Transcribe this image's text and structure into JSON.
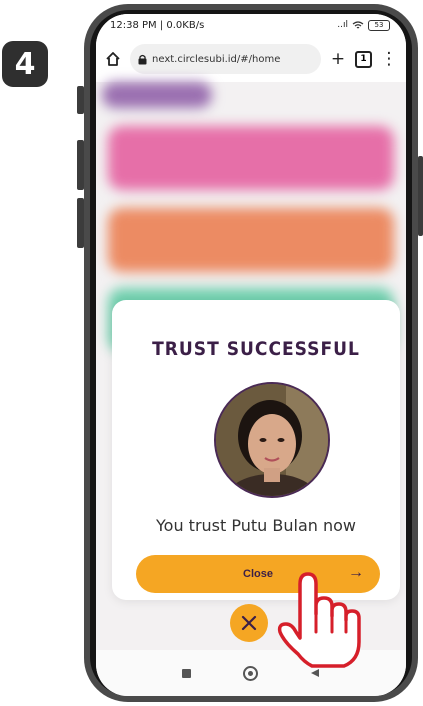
{
  "step": {
    "number": "4"
  },
  "statusbar": {
    "time_info": "12:38 PM | 0.0KB/s",
    "signal": "..ıl",
    "battery": "53"
  },
  "browser": {
    "url": "next.circlesubi.id/#/home",
    "tab_count": "1"
  },
  "modal": {
    "title": "TRUST SUCCESSFUL",
    "message": "You trust Putu Bulan now",
    "close_label": "Close"
  },
  "colors": {
    "accent": "#f5a623",
    "title": "#3b1f47",
    "card_pink": "#e66fa8",
    "card_orange": "#ec8b63",
    "card_teal": "#6fcfad",
    "hand_outline": "#d61f2a"
  },
  "icons": {
    "home": "home-icon",
    "lock": "lock-icon",
    "plus": "plus-icon",
    "more": "more-vertical-icon",
    "arrow": "arrow-right-icon",
    "x": "close-icon",
    "hand": "pointing-hand-icon"
  }
}
